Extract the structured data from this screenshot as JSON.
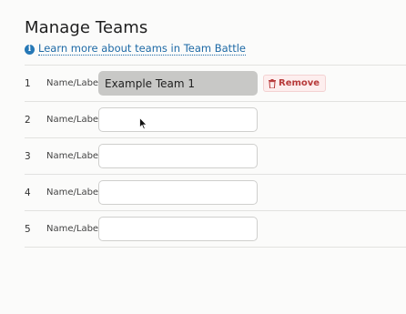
{
  "page": {
    "title": "Manage Teams",
    "learn_link": "Learn more about teams in Team Battle",
    "info_icon_glyph": "i"
  },
  "teams": [
    {
      "number": "1",
      "label": "Name/Label",
      "value": "Example Team 1",
      "placeholder": "",
      "remove_label": "Remove"
    },
    {
      "number": "2",
      "label": "Name/Label",
      "value": "",
      "placeholder": ""
    },
    {
      "number": "3",
      "label": "Name/Label",
      "value": "",
      "placeholder": ""
    },
    {
      "number": "4",
      "label": "Name/Label",
      "value": "",
      "placeholder": ""
    },
    {
      "number": "5",
      "label": "Name/Label",
      "value": "",
      "placeholder": ""
    }
  ],
  "colors": {
    "link": "#1e6aa6",
    "remove_text": "#b73a3a",
    "remove_bg": "#fdeeee",
    "filled_input_bg": "#c8c8c6"
  },
  "icons": {
    "info": "info-icon",
    "remove": "trash-icon",
    "pointer": "mouse-cursor-icon"
  }
}
